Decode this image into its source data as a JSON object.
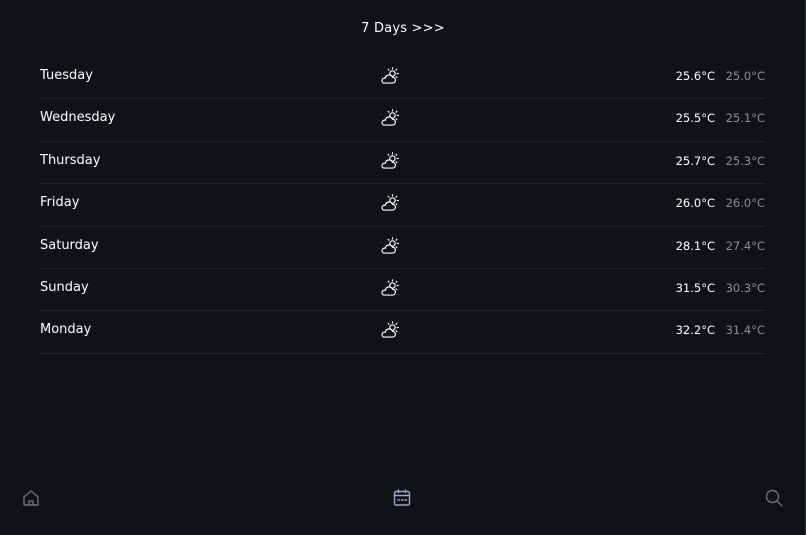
{
  "header": {
    "title": "7 Days >>>"
  },
  "forecast": [
    {
      "day": "Tuesday",
      "icon": "partly-sunny-icon",
      "high": "25.6°C",
      "low": "25.0°C"
    },
    {
      "day": "Wednesday",
      "icon": "partly-sunny-icon",
      "high": "25.5°C",
      "low": "25.1°C"
    },
    {
      "day": "Thursday",
      "icon": "partly-sunny-icon",
      "high": "25.7°C",
      "low": "25.3°C"
    },
    {
      "day": "Friday",
      "icon": "partly-sunny-icon",
      "high": "26.0°C",
      "low": "26.0°C"
    },
    {
      "day": "Saturday",
      "icon": "partly-sunny-icon",
      "high": "28.1°C",
      "low": "27.4°C"
    },
    {
      "day": "Sunday",
      "icon": "partly-sunny-icon",
      "high": "31.5°C",
      "low": "30.3°C"
    },
    {
      "day": "Monday",
      "icon": "partly-sunny-icon",
      "high": "32.2°C",
      "low": "31.4°C"
    }
  ],
  "nav": {
    "items": [
      {
        "icon": "home-icon",
        "active": false
      },
      {
        "icon": "calendar-icon",
        "active": true
      },
      {
        "icon": "search-icon",
        "active": false
      }
    ]
  },
  "colors": {
    "background": "#0e1317",
    "text": "#ffffff",
    "muted": "#8a9096",
    "active_nav": "#9aa7c4",
    "inactive_nav": "#6b7278",
    "divider": "#1f262b"
  }
}
